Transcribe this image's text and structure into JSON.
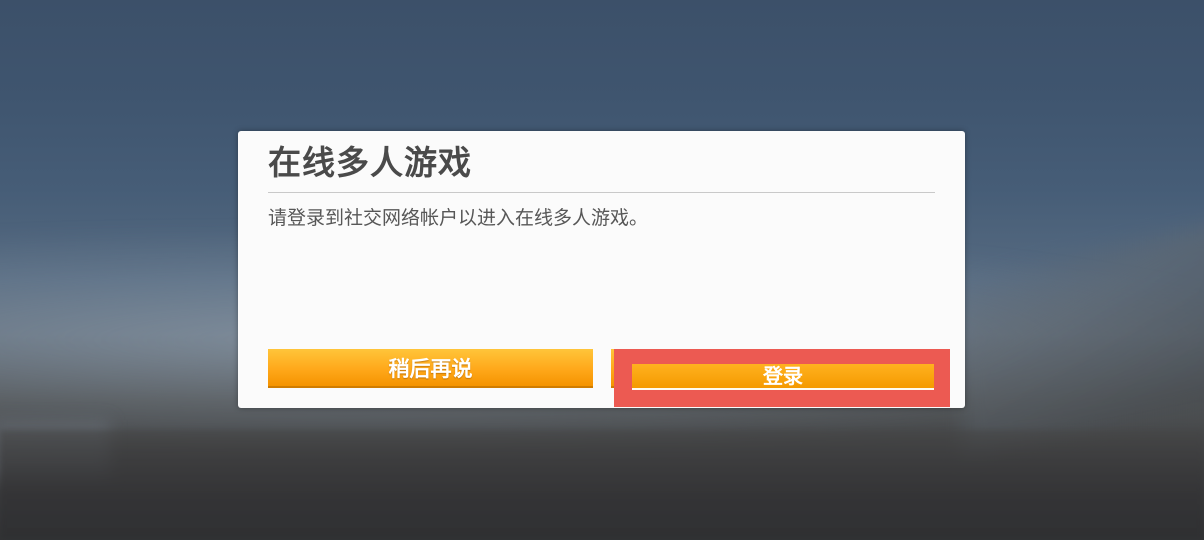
{
  "dialog": {
    "title": "在线多人游戏",
    "message": "请登录到社交网络帐户以进入在线多人游戏。",
    "buttons": {
      "later_label": "稍后再说",
      "login_label": "登录"
    }
  },
  "colors": {
    "button_orange": "#ffa81a",
    "highlight_red": "#ec5a52",
    "dialog_bg": "#fbfbfb",
    "title_text": "#4a4a4a"
  }
}
